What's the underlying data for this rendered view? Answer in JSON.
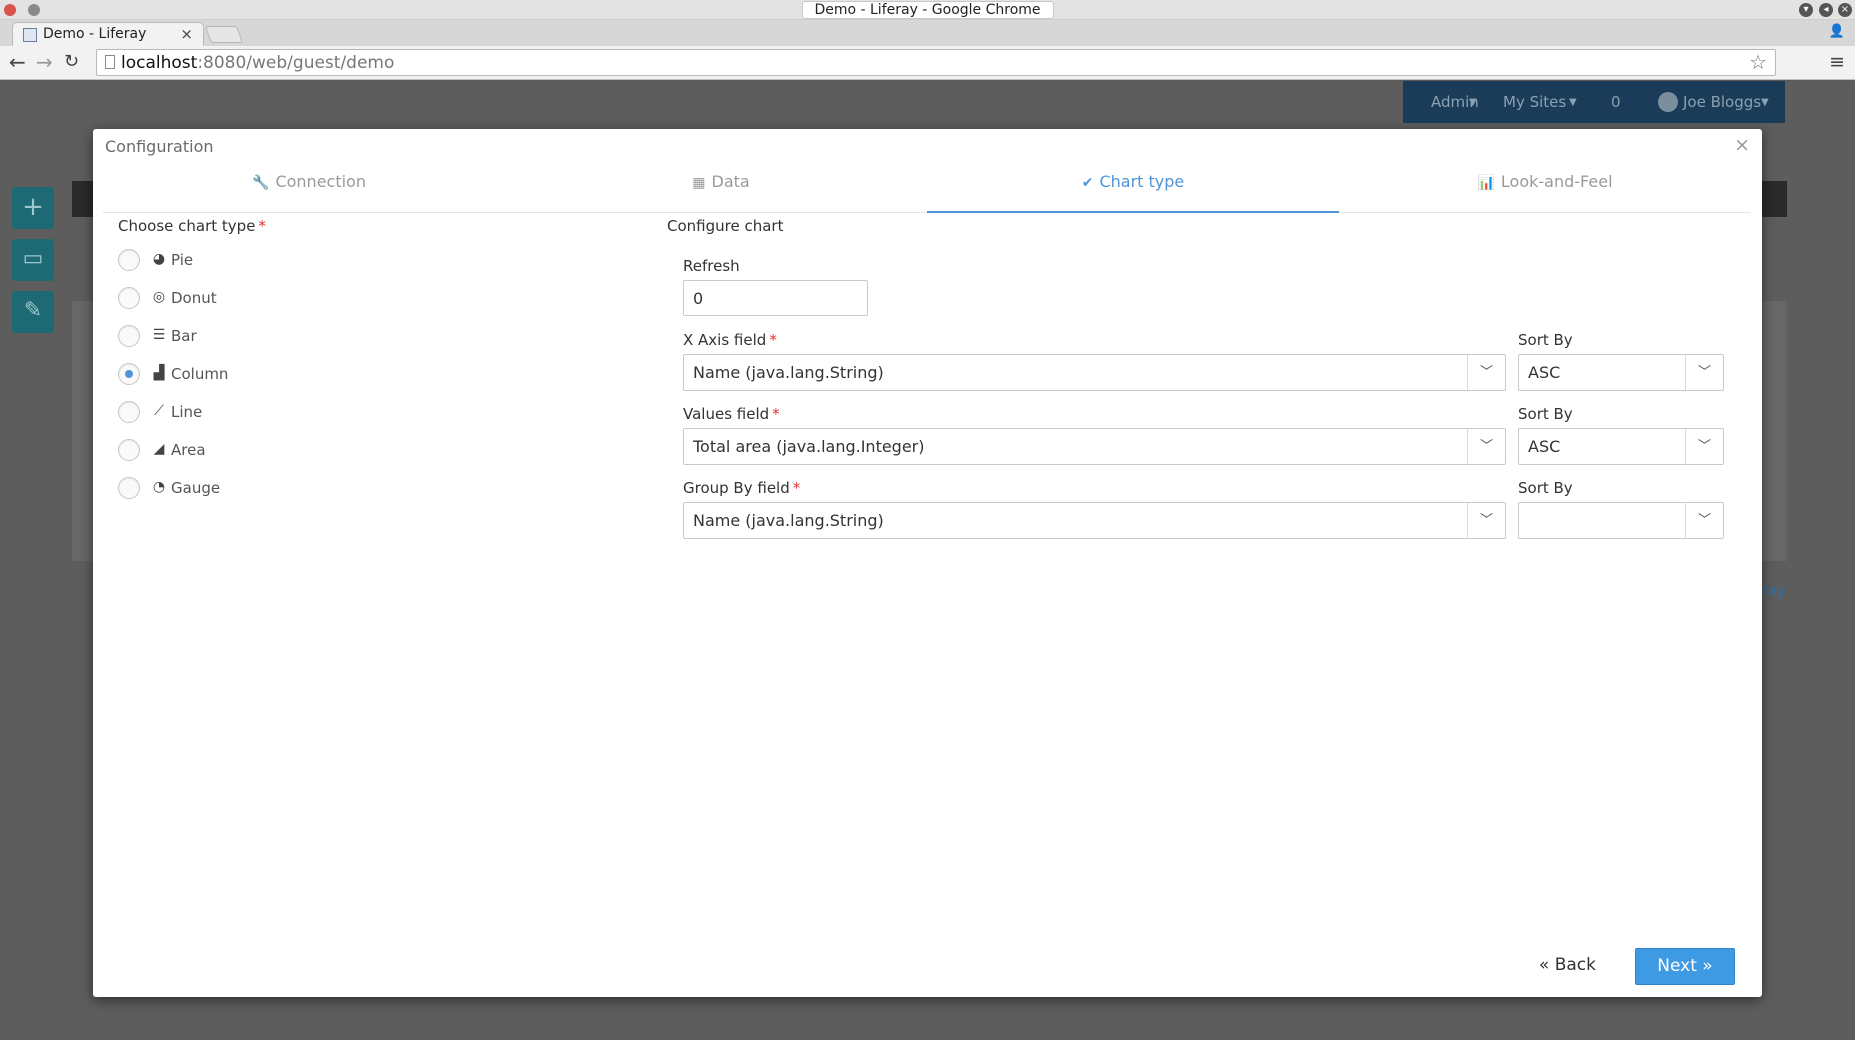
{
  "browser": {
    "window_title": "Demo - Liferay - Google Chrome",
    "tab_title": "Demo - Liferay",
    "url_host": "localhost",
    "url_rest": ":8080/web/guest/demo"
  },
  "liferay_bar": {
    "admin": "Admin",
    "my_sites": "My Sites",
    "notifications": "0",
    "user": "Joe Bloggs"
  },
  "background": {
    "link_text": "eray"
  },
  "modal": {
    "title": "Configuration",
    "steps": [
      {
        "label": "Connection",
        "icon": "wrench-icon",
        "active": false
      },
      {
        "label": "Data",
        "icon": "table-icon",
        "active": false
      },
      {
        "label": "Chart type",
        "icon": "check-icon",
        "active": true
      },
      {
        "label": "Look-and-Feel",
        "icon": "bar-chart-icon",
        "active": false
      }
    ],
    "choose_chart_type": {
      "label": "Choose chart type",
      "required_mark": "*",
      "selected": "Column",
      "options": [
        {
          "label": "Pie",
          "icon": "pie-icon"
        },
        {
          "label": "Donut",
          "icon": "donut-icon"
        },
        {
          "label": "Bar",
          "icon": "bar-icon"
        },
        {
          "label": "Column",
          "icon": "column-icon"
        },
        {
          "label": "Line",
          "icon": "line-icon"
        },
        {
          "label": "Area",
          "icon": "area-icon"
        },
        {
          "label": "Gauge",
          "icon": "gauge-icon"
        }
      ]
    },
    "configure": {
      "title": "Configure chart",
      "refresh_label": "Refresh",
      "refresh_value": "0",
      "x_axis_label": "X Axis field",
      "x_axis_value": "Name (java.lang.String)",
      "x_sort_label": "Sort By",
      "x_sort_value": "ASC",
      "values_label": "Values field",
      "values_value": "Total area (java.lang.Integer)",
      "values_sort_label": "Sort By",
      "values_sort_value": "ASC",
      "group_label": "Group By field",
      "group_value": "Name (java.lang.String)",
      "group_sort_label": "Sort By",
      "group_sort_value": "",
      "required_mark": "*"
    },
    "back_label": "Back",
    "next_label": "Next"
  },
  "colors": {
    "accent": "#4e96d6",
    "primary_button": "#3f9ae4",
    "required": "#e0322b",
    "liferay_bar": "#1a3c58"
  }
}
